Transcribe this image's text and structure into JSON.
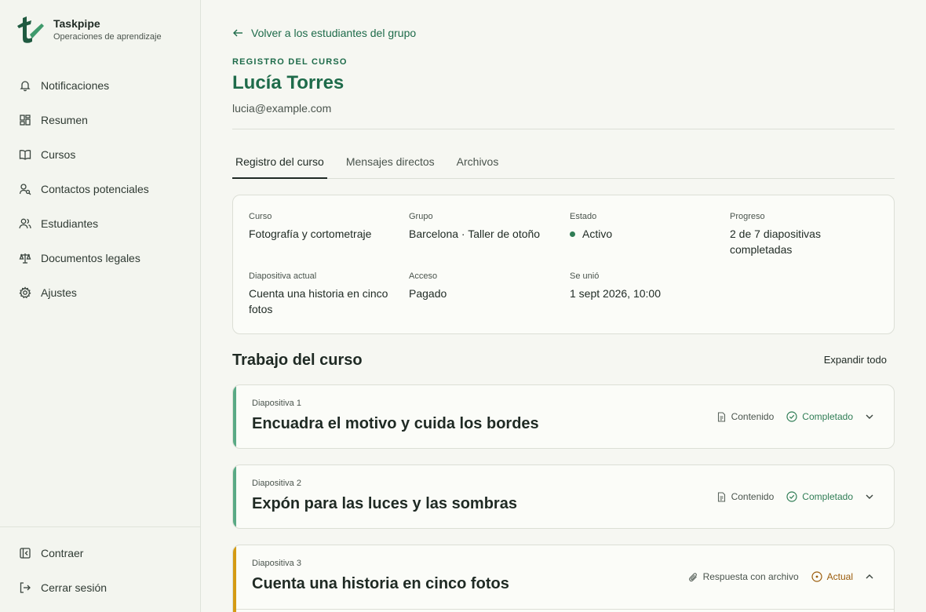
{
  "brand": {
    "name": "Taskpipe",
    "subtitle": "Operaciones de aprendizaje"
  },
  "sidebar": {
    "items": [
      {
        "label": "Notificaciones",
        "icon": "bell-icon"
      },
      {
        "label": "Resumen",
        "icon": "dashboard-icon"
      },
      {
        "label": "Cursos",
        "icon": "book-icon"
      },
      {
        "label": "Contactos potenciales",
        "icon": "user-search-icon"
      },
      {
        "label": "Estudiantes",
        "icon": "users-icon"
      },
      {
        "label": "Documentos legales",
        "icon": "scale-icon"
      },
      {
        "label": "Ajustes",
        "icon": "gear-icon"
      }
    ],
    "bottom": [
      {
        "label": "Contraer",
        "icon": "collapse-icon"
      },
      {
        "label": "Cerrar sesión",
        "icon": "logout-icon"
      }
    ]
  },
  "header": {
    "back_label": "Volver a los estudiantes del grupo",
    "eyebrow": "REGISTRO DEL CURSO",
    "student_name": "Lucía Torres",
    "student_email": "lucia@example.com"
  },
  "tabs": [
    {
      "label": "Registro del curso",
      "active": true
    },
    {
      "label": "Mensajes directos",
      "active": false
    },
    {
      "label": "Archivos",
      "active": false
    }
  ],
  "record": {
    "course_label": "Curso",
    "course_value": "Fotografía y cortometraje",
    "group_label": "Grupo",
    "group_value": "Barcelona · Taller de otoño",
    "status_label": "Estado",
    "status_value": "Activo",
    "progress_label": "Progreso",
    "progress_value": "2 de 7 diapositivas completadas",
    "current_label": "Diapositiva actual",
    "current_value": "Cuenta una historia en cinco fotos",
    "access_label": "Acceso",
    "access_value": "Pagado",
    "joined_label": "Se unió",
    "joined_value": "1 sept 2026, 10:00"
  },
  "coursework": {
    "title": "Trabajo del curso",
    "expand_all": "Expandir todo",
    "slides": [
      {
        "number": "Diapositiva 1",
        "title": "Encuadra el motivo y cuida los bordes",
        "type": "Contenido",
        "status": "Completado",
        "accent": "#5aaa85",
        "status_color": "#2f7d55"
      },
      {
        "number": "Diapositiva 2",
        "title": "Expón para las luces y las sombras",
        "type": "Contenido",
        "status": "Completado",
        "accent": "#5aaa85",
        "status_color": "#2f7d55"
      },
      {
        "number": "Diapositiva 3",
        "title": "Cuenta una historia en cinco fotos",
        "type": "Respuesta con archivo",
        "status": "Actual",
        "accent": "#d49b14",
        "status_color": "#9a5b0a"
      }
    ]
  }
}
